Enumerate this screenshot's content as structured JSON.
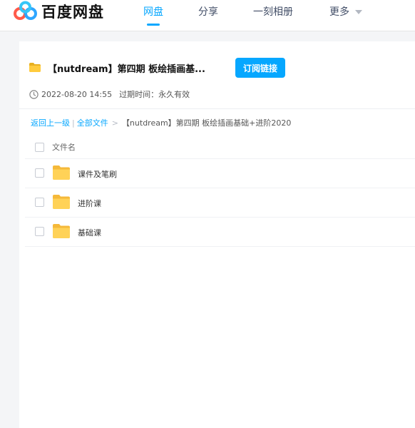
{
  "brand": {
    "name": "百度网盘",
    "icon": "baidu-netdisk-logo"
  },
  "nav": {
    "items": [
      {
        "label": "网盘",
        "active": true
      },
      {
        "label": "分享",
        "active": false
      },
      {
        "label": "一刻相册",
        "active": false
      },
      {
        "label": "更多",
        "active": false
      }
    ],
    "accent_color": "#06a7ff"
  },
  "share": {
    "title": "【nutdream】第四期 板绘插画基...",
    "subscribe_label": "订阅链接",
    "date": "2022-08-20 14:55",
    "expiry_label": "过期时间：永久有效"
  },
  "breadcrumb": {
    "back": "返回上一级",
    "separator": "|",
    "all_files": "全部文件",
    "arrow": ">",
    "current": "【nutdream】第四期 板绘插画基础+进阶2020"
  },
  "list": {
    "header": "文件名",
    "rows": [
      {
        "name": "课件及笔刷",
        "icon": "folder-icon"
      },
      {
        "name": "进阶课",
        "icon": "folder-icon"
      },
      {
        "name": "基础课",
        "icon": "folder-icon"
      }
    ]
  }
}
